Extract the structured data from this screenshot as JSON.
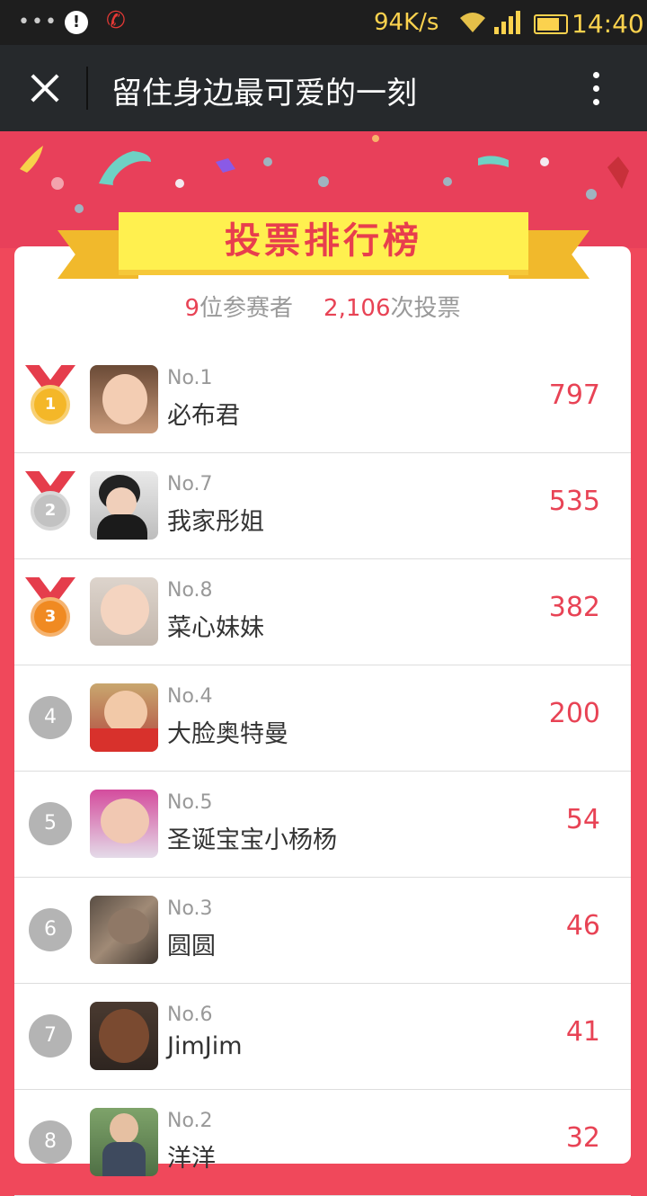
{
  "status_bar": {
    "dots": "•••",
    "alert_glyph": "!",
    "phone_glyph": "✆",
    "speed": "94K/s",
    "time": "14:40"
  },
  "titlebar": {
    "title": "留住身边最可爱的一刻",
    "close_icon": "close-icon",
    "more_icon": "more-vertical-icon"
  },
  "banner": {
    "title": "投票排行榜"
  },
  "summary": {
    "participants_num": "9",
    "participants_label": "位参赛者",
    "votes_num": "2,106",
    "votes_label": "次投票"
  },
  "colors": {
    "accent": "#e84355",
    "background": "#f0485b",
    "titlebar": "#26292c",
    "ribbon": "#fff04f"
  },
  "rankings": [
    {
      "rank": "1",
      "no": "No.1",
      "name": "必布君",
      "votes": "797"
    },
    {
      "rank": "2",
      "no": "No.7",
      "name": "我家彤姐",
      "votes": "535"
    },
    {
      "rank": "3",
      "no": "No.8",
      "name": "菜心妹妹",
      "votes": "382"
    },
    {
      "rank": "4",
      "no": "No.4",
      "name": "大脸奥特曼",
      "votes": "200"
    },
    {
      "rank": "5",
      "no": "No.5",
      "name": "圣诞宝宝小杨杨",
      "votes": "54"
    },
    {
      "rank": "6",
      "no": "No.3",
      "name": "圆圆",
      "votes": "46"
    },
    {
      "rank": "7",
      "no": "No.6",
      "name": "JimJim",
      "votes": "41"
    },
    {
      "rank": "8",
      "no": "No.2",
      "name": "洋洋",
      "votes": "32"
    }
  ]
}
